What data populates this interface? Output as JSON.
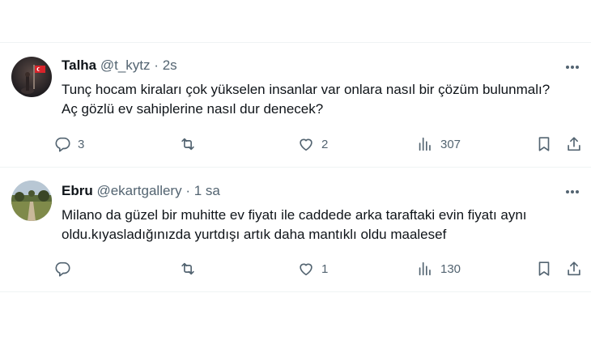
{
  "tweets": [
    {
      "name": "Talha",
      "handle": "@t_kytz",
      "sep": "·",
      "time": "2s",
      "text": "Tunç hocam kiraları çok yükselen insanlar var onlara nasıl bir çözüm bulunmalı? Aç gözlü ev sahiplerine nasıl dur denecek?",
      "replies": "3",
      "retweets": "",
      "likes": "2",
      "views": "307"
    },
    {
      "name": "Ebru",
      "handle": "@ekartgallery",
      "sep": "·",
      "time": "1 sa",
      "text": "Milano da güzel bir muhitte ev fiyatı ile caddede arka taraftaki evin fiyatı aynı oldu.kıyasladığınızda yurtdışı artık daha mantıklı oldu maalesef",
      "replies": "",
      "retweets": "",
      "likes": "1",
      "views": "130"
    }
  ],
  "colors": {
    "text": "#0f1419",
    "secondary": "#536471",
    "divider": "#eff3f4"
  },
  "icons": [
    "reply-icon",
    "retweet-icon",
    "like-icon",
    "views-icon",
    "bookmark-icon",
    "share-icon",
    "more-icon"
  ]
}
